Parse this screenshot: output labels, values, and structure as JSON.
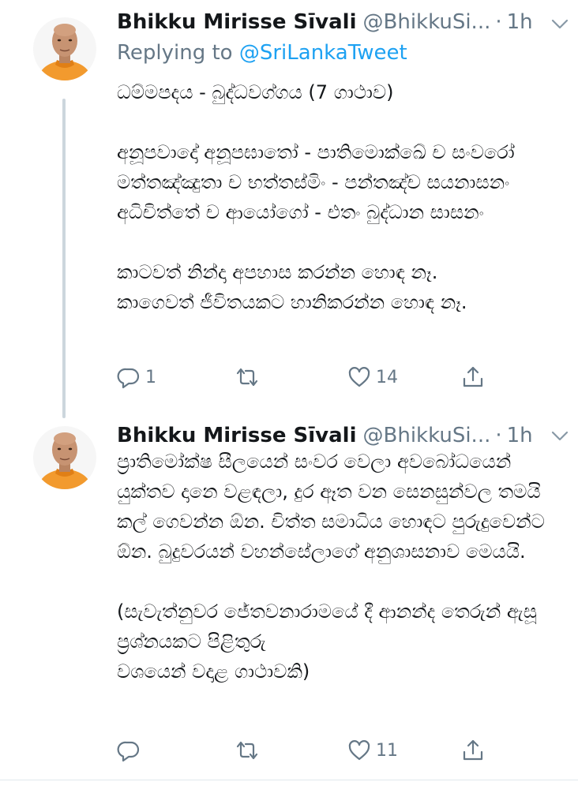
{
  "tweets": [
    {
      "author": "Bhikku Mirisse Sīvali",
      "handle": "@BhikkuSi...",
      "separator": "·",
      "time": "1h",
      "reply_prefix": "Replying to ",
      "reply_to": "@SriLankaTweet",
      "text": "ධම්මපදය - බුද්ධවග්ගය (7 ගාථාව)\n\nඅනූපවාදෝ අනූපඝාතෝ - පාතිමොක්ඛේ ච සංවරෝ\nමත්තඤ්ඤුතා ච භත්තස්මිං - පන්තඤ්ච සයනාසනං\nඅධිචිත්තේ ච ආයෝගෝ - එතං බුද්ධාන සාසනං\n\nකාටවත් නින්දා අපහාස කරන්න හොඳ නෑ.\nකාගෙවත් ජීවිතයකට හානිකරන්න හොඳ නෑ.",
      "replies": "1",
      "retweets": "",
      "likes": "14"
    },
    {
      "author": "Bhikku Mirisse Sīvali",
      "handle": "@BhikkuSi...",
      "separator": "·",
      "time": "1h",
      "text": "ප්‍රාතිමෝක්ෂ සීලයෙන් සංවර වෙලා අවබෝධයෙන් යුක්තව දානෙ වළඳලා, දුර ඈත වන සෙනසුන්වල තමයි කල් ගෙවන්න ඕන. චිත්ත සමාධිය හොඳට පුරුදුවෙන්ට ඕන. බුදුවරයන් වහන්සේලාගේ අනුශාසනාව මෙයයි.\n\n(සැවැත්නුවර ජේතවනාරාමයේ දී ආනන්ද තෙරුන් ඇසූ ප්‍රශ්නයකට පිළිතුරු\nවශයෙන් වදාළ ගාථාවකි)",
      "replies": "",
      "retweets": "",
      "likes": "11"
    }
  ],
  "icons": {
    "reply": "reply-icon",
    "retweet": "retweet-icon",
    "like": "heart-icon",
    "share": "share-icon",
    "caret": "chevron-down-icon"
  },
  "colors": {
    "link": "#1da1f2",
    "secondary_text": "#657786",
    "primary_text": "#14171a",
    "avatar_robe": "#f29a2e"
  }
}
